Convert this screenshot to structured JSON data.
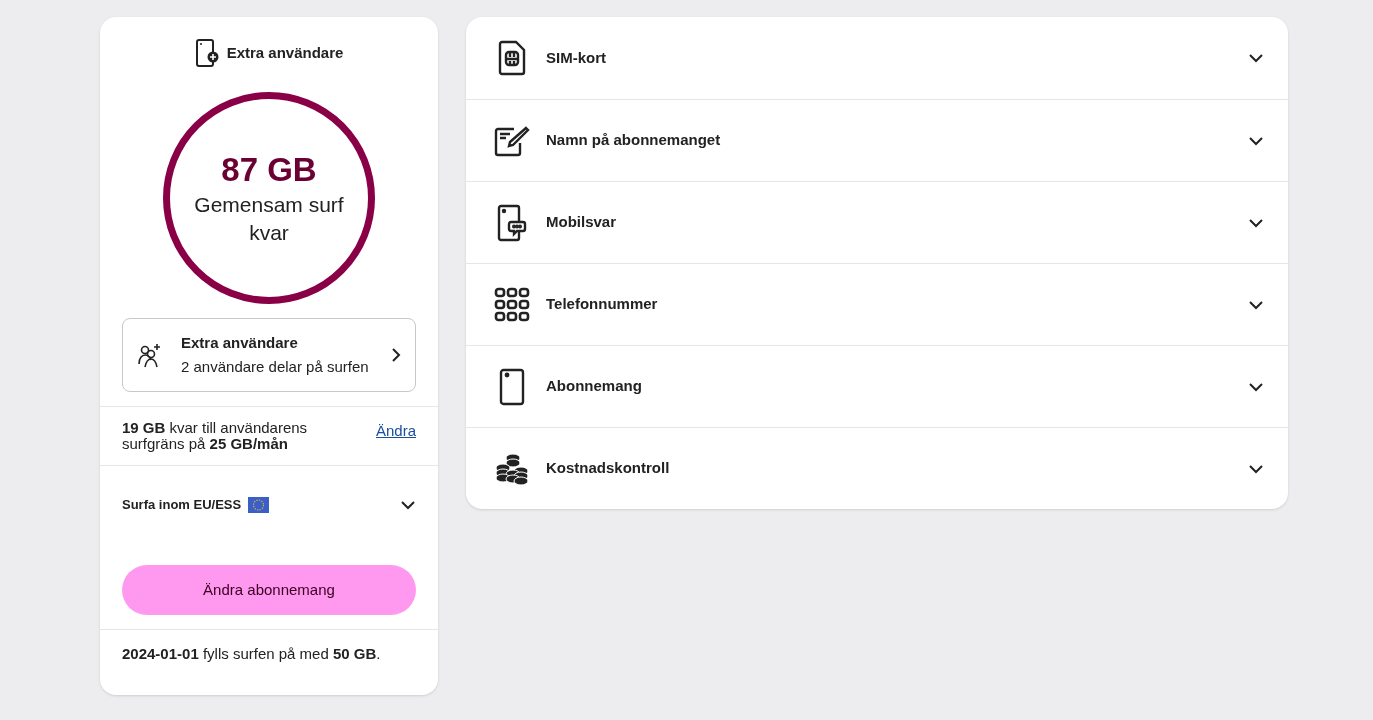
{
  "plan_card": {
    "header": "Extra användare",
    "data_circle": {
      "amount": "87 GB",
      "label": "Gemensam surf kvar"
    },
    "extra_users": {
      "title": "Extra användare",
      "subtitle": "2 användare delar på surfen"
    },
    "limit": {
      "text": "**19 GB** kvar till användarens surfgräns på **25 GB/mån**",
      "link": "Ändra"
    },
    "eu_roaming": {
      "label": "Surfa inom EU/ESS",
      "expanded": false
    },
    "button": "Ändra abonnemang",
    "refill_note": "**2024-01-01** fylls surfen på med **50 GB**."
  },
  "settings": [
    {
      "kind": "sim",
      "label": "SIM-kort",
      "expanded": false
    },
    {
      "kind": "edit",
      "label": "Namn på abonnemanget",
      "expanded": false
    },
    {
      "kind": "voicemail",
      "label": "Mobilsvar",
      "expanded": false
    },
    {
      "kind": "keypad",
      "label": "Telefonnummer",
      "expanded": false
    },
    {
      "kind": "phone",
      "label": "Abonnemang",
      "expanded": false
    },
    {
      "kind": "coins",
      "label": "Kostnadskontroll",
      "expanded": false
    }
  ]
}
